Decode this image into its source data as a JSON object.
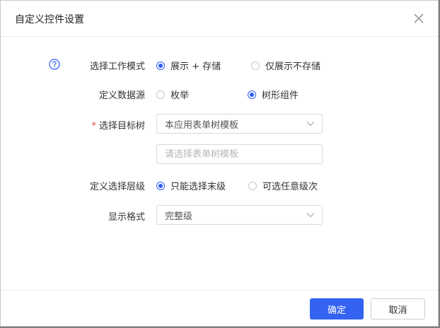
{
  "dialog": {
    "title": "自定义控件设置"
  },
  "form": {
    "mode": {
      "label": "选择工作模式",
      "options": [
        {
          "label": "展示 + 存储",
          "selected": true
        },
        {
          "label": "仅展示不存储",
          "selected": false
        }
      ]
    },
    "source": {
      "label": "定义数据源",
      "options": [
        {
          "label": "枚举",
          "selected": false
        },
        {
          "label": "树形组件",
          "selected": true
        }
      ]
    },
    "target_tree": {
      "required_mark": "*",
      "label": "选择目标树",
      "selected_value": "本应用表单树模板",
      "template_placeholder": "请选择表单树模板"
    },
    "level": {
      "label": "定义选择层级",
      "options": [
        {
          "label": "只能选择末级",
          "selected": true
        },
        {
          "label": "可选任意级次",
          "selected": false
        }
      ]
    },
    "display_format": {
      "label": "显示格式",
      "selected_value": "完整级"
    }
  },
  "footer": {
    "confirm_label": "确定",
    "cancel_label": "取消"
  },
  "colors": {
    "accent": "#3363f0",
    "required": "#e34d4d"
  },
  "icons": {
    "help": "help-circle-icon",
    "close": "close-icon",
    "dropdown": "chevron-down-icon"
  }
}
